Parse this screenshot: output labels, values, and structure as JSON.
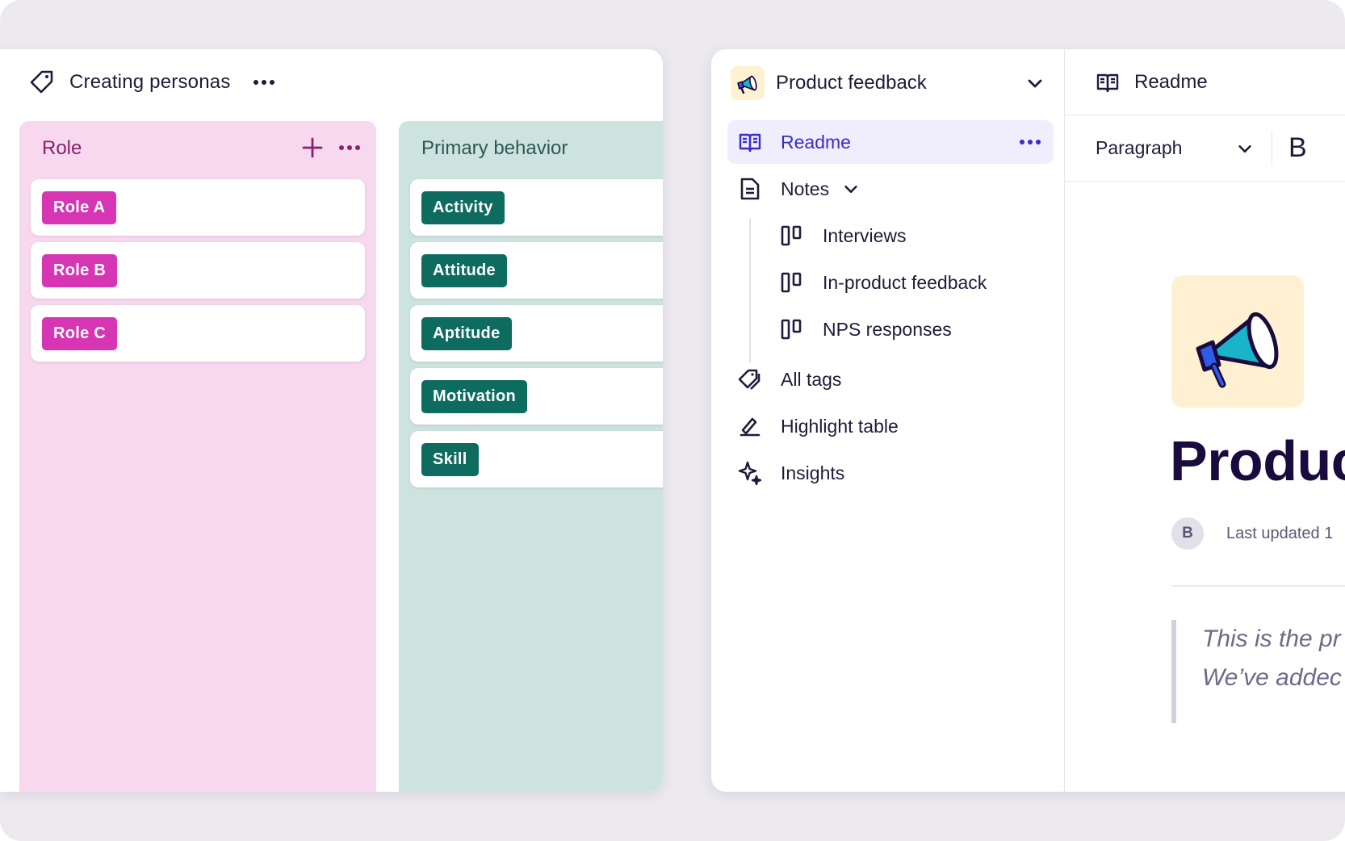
{
  "board": {
    "title": "Creating personas",
    "columns": [
      {
        "title": "Role",
        "cards": [
          "Role A",
          "Role B",
          "Role C"
        ]
      },
      {
        "title": "Primary behavior",
        "cards": [
          "Activity",
          "Attitude",
          "Aptitude",
          "Motivation",
          "Skill"
        ]
      }
    ]
  },
  "project": {
    "name": "Product feedback",
    "nav": {
      "readme": "Readme",
      "notes": "Notes",
      "sub": [
        "Interviews",
        "In-product feedback",
        "NPS responses"
      ],
      "all_tags": "All tags",
      "highlight_table": "Highlight table",
      "insights": "Insights"
    }
  },
  "doc": {
    "tab_label": "Readme",
    "format": "Paragraph",
    "bold": "B",
    "title": "Produc",
    "author_initial": "B",
    "meta": "Last updated 1",
    "quote_lines": [
      "This is the pr",
      "We’ve addec"
    ]
  },
  "icons": {
    "tag": "tag-icon",
    "more": "more-dots-icon",
    "plus": "plus-icon",
    "chevron": "chevron-down-icon",
    "book": "book-open-icon",
    "file": "file-text-icon",
    "board": "board-columns-icon",
    "tags": "tags-icon",
    "highlight": "highlight-pen-icon",
    "sparkle": "sparkle-icon",
    "megaphone": "megaphone-icon"
  },
  "colors": {
    "accent": "#3A2BD1",
    "role_chip": "#D636B4",
    "behavior_chip": "#0D6B60",
    "role_column": "#F7D8EF",
    "behavior_column": "#CDE3E0"
  }
}
